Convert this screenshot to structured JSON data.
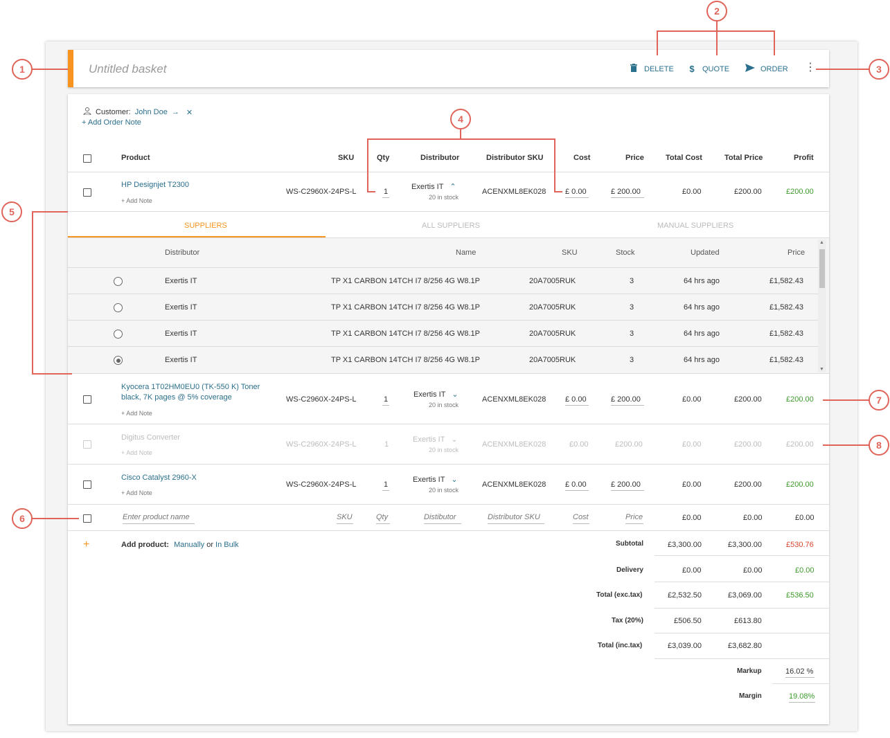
{
  "header": {
    "title": "Untitled basket",
    "delete_label": "DELETE",
    "quote_label": "QUOTE",
    "order_label": "ORDER"
  },
  "customer": {
    "label": "Customer:",
    "name": "John Doe",
    "add_note": "+ Add Order Note"
  },
  "columns": {
    "product": "Product",
    "sku": "SKU",
    "qty": "Qty",
    "distributor": "Distributor",
    "distributor_sku": "Distributor SKU",
    "cost": "Cost",
    "price": "Price",
    "total_cost": "Total Cost",
    "total_price": "Total Price",
    "profit": "Profit"
  },
  "rows": [
    {
      "name": "HP Designjet T2300",
      "sku": "WS-C2960X-24PS-L",
      "qty": "1",
      "distributor": "Exertis IT",
      "stock": "20 in stock",
      "dsku": "ACENXML8EK028",
      "cost": "£ 0.00",
      "price": "£ 200.00",
      "total_cost": "£0.00",
      "total_price": "£200.00",
      "profit": "£200.00",
      "note": "+ Add Note"
    },
    {
      "name": "Kyocera 1T02HM0EU0 (TK-550 K) Toner",
      "name2": "black, 7K pages @ 5% coverage",
      "sku": "WS-C2960X-24PS-L",
      "qty": "1",
      "distributor": "Exertis IT",
      "stock": "20 in stock",
      "dsku": "ACENXML8EK028",
      "cost": "£ 0.00",
      "price": "£ 200.00",
      "total_cost": "£0.00",
      "total_price": "£200.00",
      "profit": "£200.00",
      "note": "+ Add Note"
    },
    {
      "name": "Digitus Converter",
      "sku": "WS-C2960X-24PS-L",
      "qty": "1",
      "distributor": "Exertis IT",
      "stock": "20 in stock",
      "dsku": "ACENXML8EK028",
      "cost": "£0.00",
      "price": "£200.00",
      "total_cost": "£0.00",
      "total_price": "£200.00",
      "profit": "£200.00",
      "note": "+ Add Note"
    },
    {
      "name": "Cisco Catalyst 2960-X",
      "sku": "WS-C2960X-24PS-L",
      "qty": "1",
      "distributor": "Exertis IT",
      "stock": "20 in stock",
      "dsku": "ACENXML8EK028",
      "cost": "£ 0.00",
      "price": "£ 200.00",
      "total_cost": "£0.00",
      "total_price": "£200.00",
      "profit": "£200.00",
      "note": "+ Add Note"
    }
  ],
  "tabs": {
    "suppliers": "SUPPLIERS",
    "all": "ALL SUPPLIERS",
    "manual": "MANUAL SUPPLIERS"
  },
  "sup_columns": {
    "distributor": "Distributor",
    "name": "Name",
    "sku": "SKU",
    "stock": "Stock",
    "updated": "Updated",
    "price": "Price"
  },
  "suppliers": [
    {
      "distributor": "Exertis IT",
      "name": "TP X1 CARBON 14TCH I7 8/256 4G W8.1P",
      "sku": "20A7005RUK",
      "stock": "3",
      "updated": "64 hrs ago",
      "price": "£1,582.43",
      "selected": false
    },
    {
      "distributor": "Exertis IT",
      "name": "TP X1 CARBON 14TCH I7 8/256 4G W8.1P",
      "sku": "20A7005RUK",
      "stock": "3",
      "updated": "64 hrs ago",
      "price": "£1,582.43",
      "selected": false
    },
    {
      "distributor": "Exertis IT",
      "name": "TP X1 CARBON 14TCH I7 8/256 4G W8.1P",
      "sku": "20A7005RUK",
      "stock": "3",
      "updated": "64 hrs ago",
      "price": "£1,582.43",
      "selected": false
    },
    {
      "distributor": "Exertis IT",
      "name": "TP X1 CARBON 14TCH I7 8/256 4G W8.1P",
      "sku": "20A7005RUK",
      "stock": "3",
      "updated": "64 hrs ago",
      "price": "£1,582.43",
      "selected": true
    }
  ],
  "new_row": {
    "product_placeholder": "Enter product name",
    "sku_placeholder": "SKU",
    "qty_placeholder": "Qty",
    "distributor_placeholder": "Distibutor",
    "dsku_placeholder": "Distributor SKU",
    "cost_placeholder": "Cost",
    "price_placeholder": "Price",
    "total_cost": "£0.00",
    "total_price": "£0.00",
    "profit": "£0.00"
  },
  "add_product": {
    "label": "Add product:",
    "manually": "Manually",
    "or": "or",
    "bulk": "In Bulk"
  },
  "totals": [
    {
      "label": "Subtotal",
      "cost": "£3,300.00",
      "price": "£3,300.00",
      "profit": "£530.76",
      "profit_color": "red"
    },
    {
      "label": "Delivery",
      "cost": "£0.00",
      "price": "£0.00",
      "profit": "£0.00",
      "profit_color": "green"
    },
    {
      "label": "Total (exc.tax)",
      "cost": "£2,532.50",
      "price": "£3,069.00",
      "profit": "£536.50",
      "profit_color": "green"
    },
    {
      "label": "Tax (20%)",
      "cost": "£506.50",
      "price": "£613.80",
      "profit": "",
      "profit_color": ""
    },
    {
      "label": "Total (inc.tax)",
      "cost": "£3,039.00",
      "price": "£3,682.80",
      "profit": "",
      "profit_color": ""
    }
  ],
  "markup": {
    "label": "Markup",
    "value": "16.02 %"
  },
  "margin": {
    "label": "Margin",
    "value": "19.08%"
  },
  "annotations": [
    "1",
    "2",
    "3",
    "4",
    "5",
    "6",
    "7",
    "8"
  ],
  "icons": {
    "delete": "trash-icon",
    "quote": "dollar-icon",
    "order": "send-icon",
    "more": "kebab-icon",
    "customer": "user-icon",
    "remove": "close-icon",
    "go": "arrow-right-icon",
    "add": "plus-icon"
  }
}
